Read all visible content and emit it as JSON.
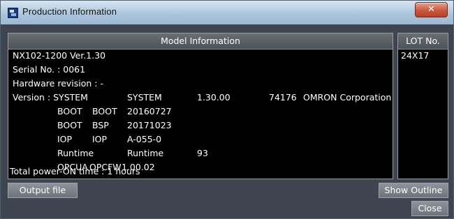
{
  "window": {
    "title": "Production Information",
    "close_glyph": "✕"
  },
  "model": {
    "header": "Model Information",
    "model_line": "NX102-1200 Ver.1.30",
    "serial": "Serial No. : 0061",
    "hardware_revision": "Hardware revision : -",
    "version_label": "Version : SYSTEM",
    "components": [
      {
        "name": "",
        "type": "SYSTEM",
        "version": "1.30.00",
        "code": "74176",
        "vendor": "OMRON Corporation"
      },
      {
        "name": "BOOT",
        "type": "BOOT",
        "version": "20160727"
      },
      {
        "name": "BOOT",
        "type": "BSP",
        "version": "20171023"
      },
      {
        "name": "IOP",
        "type": "IOP",
        "version": "A-055-0"
      },
      {
        "name": "Runtime",
        "type": "Runtime",
        "version": "93"
      },
      {
        "name": "OPCUA",
        "type": "OPCFW",
        "version": "1.00.02"
      }
    ],
    "power_on_time": "Total power-ON time : 1 hours"
  },
  "lot": {
    "header": "LOT No.",
    "value": "24X17"
  },
  "buttons": {
    "output_file": "Output file",
    "show_outline": "Show Outline",
    "close": "Close"
  },
  "icons": {
    "app": "omron-app-icon",
    "close": "close-icon"
  }
}
